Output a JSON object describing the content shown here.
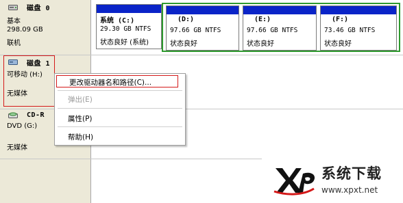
{
  "disks": [
    {
      "title": "磁盘 0",
      "lines": [
        "基本",
        "298.09 GB",
        "联机"
      ],
      "partitions": [
        {
          "label": "系统  (C:)",
          "size": "29.30 GB NTFS",
          "status": "状态良好 (系统)"
        },
        {
          "label": "(D:)",
          "size": "97.66 GB NTFS",
          "status": "状态良好"
        },
        {
          "label": "(E:)",
          "size": "97.66 GB NTFS",
          "status": "状态良好"
        },
        {
          "label": "(F:)",
          "size": "73.46 GB NTFS",
          "status": "状态良好"
        }
      ]
    },
    {
      "title": "磁盘 1",
      "lines": [
        "可移动 (H:)",
        "无媒体"
      ]
    },
    {
      "title": "CD-R",
      "lines": [
        "DVD (G:)",
        "无媒体"
      ]
    }
  ],
  "context_menu": {
    "items": [
      {
        "label": "更改驱动器名和路径(C)...",
        "enabled": true
      },
      {
        "label": "弹出(E)",
        "enabled": false
      },
      {
        "label": "属性(P)",
        "enabled": true
      },
      {
        "label": "帮助(H)",
        "enabled": true
      }
    ]
  },
  "watermark": {
    "logo_text": "XP",
    "brand": "系统下载",
    "url": "www.xpxt.net"
  },
  "colors": {
    "primary_partition_bar": "#0a24c8",
    "extended_partition_border": "#2e9a2e",
    "highlight_box": "#d41818",
    "label_panel_bg": "#ece9d8"
  }
}
